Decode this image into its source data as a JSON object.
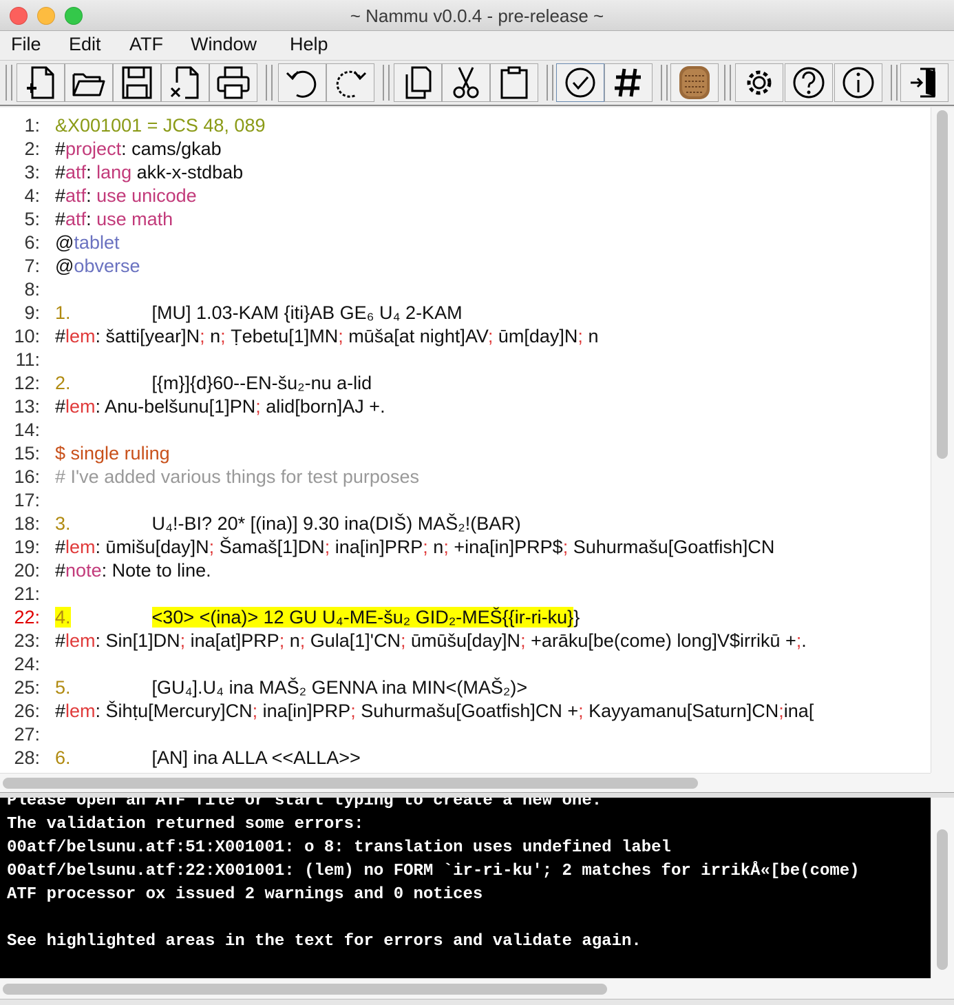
{
  "window": {
    "title": "~ Nammu v0.0.4 - pre-release ~"
  },
  "menu": [
    "File",
    "Edit",
    "ATF",
    "Window",
    "Help"
  ],
  "toolbar": [
    {
      "name": "new-file-icon",
      "group": 1
    },
    {
      "name": "open-folder-icon",
      "group": 1
    },
    {
      "name": "save-icon",
      "group": 1
    },
    {
      "name": "close-file-icon",
      "group": 1
    },
    {
      "name": "print-icon",
      "group": 1
    },
    {
      "name": "undo-icon",
      "group": 2
    },
    {
      "name": "redo-icon",
      "group": 2
    },
    {
      "name": "copy-icon",
      "group": 3
    },
    {
      "name": "cut-icon",
      "group": 3
    },
    {
      "name": "paste-icon",
      "group": 3
    },
    {
      "name": "validate-icon",
      "group": 4
    },
    {
      "name": "lemmatise-icon",
      "group": 4
    },
    {
      "name": "tablet-icon",
      "group": 5
    },
    {
      "name": "settings-icon",
      "group": 6
    },
    {
      "name": "help-icon",
      "group": 6
    },
    {
      "name": "info-icon",
      "group": 6
    },
    {
      "name": "quit-icon",
      "group": 7
    }
  ],
  "editor": {
    "error_line": "22",
    "lines": [
      {
        "n": "1:",
        "segs": [
          [
            "olive",
            "&X001001 = JCS 48, 089"
          ]
        ]
      },
      {
        "n": "2:",
        "segs": [
          [
            "",
            "#"
          ],
          [
            "magenta",
            "project"
          ],
          [
            "",
            ": cams/gkab"
          ]
        ]
      },
      {
        "n": "3:",
        "segs": [
          [
            "",
            "#"
          ],
          [
            "magenta",
            "atf"
          ],
          [
            "",
            ": "
          ],
          [
            "magenta",
            "lang"
          ],
          [
            "",
            " akk-x-stdbab"
          ]
        ]
      },
      {
        "n": "4:",
        "segs": [
          [
            "",
            "#"
          ],
          [
            "magenta",
            "atf"
          ],
          [
            "",
            ": "
          ],
          [
            "magenta",
            "use unicode"
          ]
        ]
      },
      {
        "n": "5:",
        "segs": [
          [
            "",
            "#"
          ],
          [
            "magenta",
            "atf"
          ],
          [
            "",
            ": "
          ],
          [
            "magenta",
            "use math"
          ]
        ]
      },
      {
        "n": "6:",
        "segs": [
          [
            "",
            "@"
          ],
          [
            "blue",
            "tablet"
          ]
        ]
      },
      {
        "n": "7:",
        "segs": [
          [
            "",
            "@"
          ],
          [
            "blue",
            "obverse"
          ]
        ]
      },
      {
        "n": "8:",
        "segs": []
      },
      {
        "n": "9:",
        "segs": [
          [
            "gold",
            "1."
          ],
          [
            "tab",
            ""
          ],
          [
            "",
            "[MU] 1.03-KAM {iti}AB GE₆ U₄ 2-KAM"
          ]
        ]
      },
      {
        "n": "10:",
        "segs": [
          [
            "",
            "#"
          ],
          [
            "red",
            "lem"
          ],
          [
            "",
            ": šatti[year]N"
          ],
          [
            "red",
            ";"
          ],
          [
            "",
            " n"
          ],
          [
            "red",
            ";"
          ],
          [
            "",
            " Ṭebetu[1]MN"
          ],
          [
            "red",
            ";"
          ],
          [
            "",
            " mūša[at night]AV"
          ],
          [
            "red",
            ";"
          ],
          [
            "",
            " ūm[day]N"
          ],
          [
            "red",
            ";"
          ],
          [
            "",
            " n"
          ]
        ]
      },
      {
        "n": "11:",
        "segs": []
      },
      {
        "n": "12:",
        "segs": [
          [
            "gold",
            "2."
          ],
          [
            "tab",
            ""
          ],
          [
            "",
            "[{m}]{d}60--EN-šu₂-nu a-lid"
          ]
        ]
      },
      {
        "n": "13:",
        "segs": [
          [
            "",
            "#"
          ],
          [
            "red",
            "lem"
          ],
          [
            "",
            ": Anu-belšunu[1]PN"
          ],
          [
            "red",
            ";"
          ],
          [
            "",
            " alid[born]AJ +."
          ]
        ]
      },
      {
        "n": "14:",
        "segs": []
      },
      {
        "n": "15:",
        "segs": [
          [
            "orange",
            "$ single ruling"
          ]
        ]
      },
      {
        "n": "16:",
        "segs": [
          [
            "gray",
            "# I've added various things for test purposes"
          ]
        ]
      },
      {
        "n": "17:",
        "segs": []
      },
      {
        "n": "18:",
        "segs": [
          [
            "gold",
            "3."
          ],
          [
            "tab",
            ""
          ],
          [
            "",
            "U₄!-BI? 20* [(ina)] 9.30 ina(DIŠ) MAŠ₂!(BAR)"
          ]
        ]
      },
      {
        "n": "19:",
        "segs": [
          [
            "",
            "#"
          ],
          [
            "red",
            "lem"
          ],
          [
            "",
            ": ūmišu[day]N"
          ],
          [
            "red",
            ";"
          ],
          [
            "",
            " Šamaš[1]DN"
          ],
          [
            "red",
            ";"
          ],
          [
            "",
            " ina[in]PRP"
          ],
          [
            "red",
            ";"
          ],
          [
            "",
            " n"
          ],
          [
            "red",
            ";"
          ],
          [
            "",
            " +ina[in]PRP$"
          ],
          [
            "red",
            ";"
          ],
          [
            "",
            " Suhurmašu[Goatfish]CN"
          ]
        ]
      },
      {
        "n": "20:",
        "segs": [
          [
            "",
            "#"
          ],
          [
            "magenta",
            "note"
          ],
          [
            "",
            ": Note to line."
          ]
        ]
      },
      {
        "n": "21:",
        "segs": []
      },
      {
        "n": "22:",
        "segs": [
          [
            "gold-hl",
            "4."
          ],
          [
            "tab-hl",
            ""
          ],
          [
            "hl",
            "<30> <(ina)> 12 GU U₄-ME-šu₂ GID₂-MEŠ{{ir-ri-ku}"
          ],
          [
            "",
            "}"
          ]
        ]
      },
      {
        "n": "23:",
        "segs": [
          [
            "",
            "#"
          ],
          [
            "red",
            "lem"
          ],
          [
            "",
            ": Sin[1]DN"
          ],
          [
            "red",
            ";"
          ],
          [
            "",
            " ina[at]PRP"
          ],
          [
            "red",
            ";"
          ],
          [
            "",
            " n"
          ],
          [
            "red",
            ";"
          ],
          [
            "",
            " Gula[1]'CN"
          ],
          [
            "red",
            ";"
          ],
          [
            "",
            " ūmūšu[day]N"
          ],
          [
            "red",
            ";"
          ],
          [
            "",
            " +arāku[be(come) long]V$irrikū +"
          ],
          [
            "red",
            ";"
          ],
          [
            "",
            "."
          ]
        ]
      },
      {
        "n": "24:",
        "segs": []
      },
      {
        "n": "25:",
        "segs": [
          [
            "gold",
            "5."
          ],
          [
            "tab",
            ""
          ],
          [
            "",
            "[GU₄].U₄ ina MAŠ₂ GENNA ina MIN<(MAŠ₂)>"
          ]
        ]
      },
      {
        "n": "26:",
        "segs": [
          [
            "",
            "#"
          ],
          [
            "red",
            "lem"
          ],
          [
            "",
            ": Šihṭu[Mercury]CN"
          ],
          [
            "red",
            ";"
          ],
          [
            "",
            " ina[in]PRP"
          ],
          [
            "red",
            ";"
          ],
          [
            "",
            " Suhurmašu[Goatfish]CN +"
          ],
          [
            "red",
            ";"
          ],
          [
            "",
            " Kayyamanu[Saturn]CN"
          ],
          [
            "red",
            ";"
          ],
          [
            "",
            "ina["
          ]
        ]
      },
      {
        "n": "27:",
        "segs": []
      },
      {
        "n": "28:",
        "segs": [
          [
            "gold",
            "6."
          ],
          [
            "tab",
            ""
          ],
          [
            "",
            "[AN] ina ALLA <<ALLA>>"
          ]
        ]
      }
    ]
  },
  "console": {
    "lines": [
      "Please open an ATF file or start typing to create a new one.",
      "The validation returned some errors:",
      "00atf/belsunu.atf:51:X001001: o 8: translation uses undefined label",
      "00atf/belsunu.atf:22:X001001: (lem) no FORM `ir-ri-ku'; 2 matches for irrikÅ«[be(come)",
      "ATF processor ox issued 2 warnings and 0 notices",
      "",
      "See highlighted areas in the text for errors and validate again."
    ]
  }
}
